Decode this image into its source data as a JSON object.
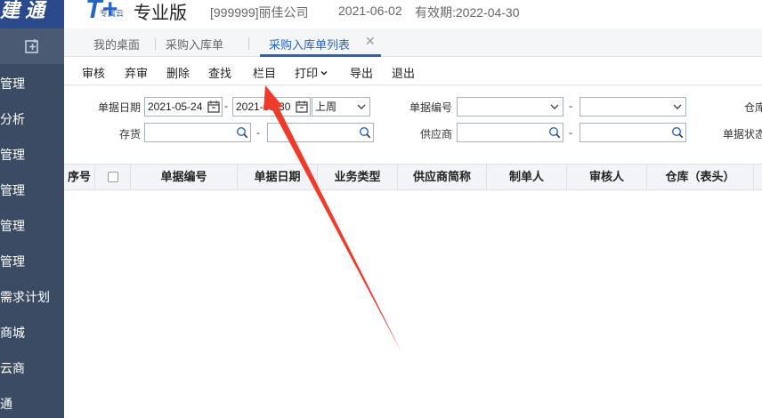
{
  "header": {
    "logo_text": "建 通",
    "brand_mark": "T+",
    "brand_sub": "专属云",
    "brand_name": "专业版",
    "company": "[999999]丽佳公司",
    "date": "2021-06-02",
    "valid": "有效期:2022-04-30"
  },
  "sidebar": {
    "items": [
      "管理",
      "分析",
      "管理",
      "管理",
      "管理",
      "管理",
      "需求计划",
      "商城",
      "云商",
      "通"
    ]
  },
  "tabs": [
    {
      "label": "我的桌面"
    },
    {
      "label": "采购入库单"
    },
    {
      "label": "采购入库单列表"
    }
  ],
  "toolbar": {
    "buttons": [
      "审核",
      "弃审",
      "删除",
      "查找",
      "栏目",
      "打印",
      "导出",
      "退出"
    ]
  },
  "filters": {
    "doc_date_label": "单据日期",
    "date_from": "2021-05-24",
    "date_to": "2021-05-30",
    "period": "上周",
    "doc_no_label": "单据编号",
    "warehouse_label": "仓库",
    "inventory_label": "存货",
    "supplier_label": "供应商",
    "doc_status_label": "单据状态",
    "dash": "-"
  },
  "grid": {
    "columns": [
      "序号",
      "单据编号",
      "单据日期",
      "业务类型",
      "供应商简称",
      "制单人",
      "审核人",
      "仓库（表头）"
    ]
  },
  "colors": {
    "sidebar": "#3b4b63",
    "accent": "#2a63c4",
    "arrow": "#f03a2a"
  }
}
